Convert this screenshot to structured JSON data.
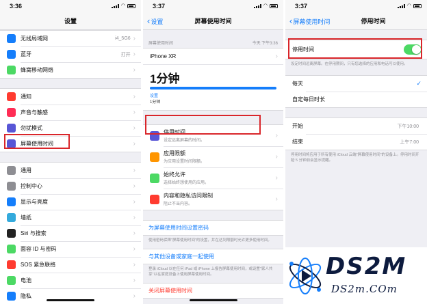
{
  "colors": {
    "accent": "#157efb",
    "highlight": "#d9252a",
    "toggle_on": "#4cd964",
    "destructive": "#ff3b30"
  },
  "p1": {
    "time": "3:36",
    "title": "设置",
    "group1": [
      {
        "label": "无线局域网",
        "value": "i4_5G6",
        "icon": "wifi-icon",
        "color": "#157efb"
      },
      {
        "label": "蓝牙",
        "value": "打开",
        "icon": "bluetooth-icon",
        "color": "#157efb"
      },
      {
        "label": "蜂窝移动网络",
        "value": "",
        "icon": "cellular-icon",
        "color": "#4cd964"
      }
    ],
    "group2": [
      {
        "label": "通知",
        "icon": "notifications-icon",
        "color": "#ff3b30"
      },
      {
        "label": "声音与触感",
        "icon": "sounds-icon",
        "color": "#ff2d55"
      },
      {
        "label": "勿扰模式",
        "icon": "moon-icon",
        "color": "#5856d6"
      },
      {
        "label": "屏幕使用时间",
        "icon": "hourglass-icon",
        "color": "#5856d6"
      }
    ],
    "group3": [
      {
        "label": "通用",
        "icon": "gear-icon",
        "color": "#8e8e93"
      },
      {
        "label": "控制中心",
        "icon": "control-center-icon",
        "color": "#8e8e93"
      },
      {
        "label": "显示与亮度",
        "icon": "display-icon",
        "color": "#157efb"
      },
      {
        "label": "墙纸",
        "icon": "wallpaper-icon",
        "color": "#34aadc"
      },
      {
        "label": "Siri 与搜索",
        "icon": "siri-icon",
        "color": "#222222"
      },
      {
        "label": "面容 ID 与密码",
        "icon": "faceid-icon",
        "color": "#4cd964"
      },
      {
        "label": "SOS 紧急联络",
        "icon": "sos-icon",
        "color": "#ff3b30"
      },
      {
        "label": "电池",
        "icon": "battery-icon",
        "color": "#4cd964"
      },
      {
        "label": "隐私",
        "icon": "hand-icon",
        "color": "#157efb"
      }
    ]
  },
  "p2": {
    "time": "3:37",
    "back": "设置",
    "title": "屏幕使用时间",
    "header_left": "屏幕使用时间",
    "header_right": "今天 下午3:36",
    "device": "iPhone XR",
    "big_time": "1分钟",
    "cat_label": "设置",
    "cat_value": "1分钟",
    "items": [
      {
        "title": "停用时间",
        "sub": "设定远离屏幕的时间。",
        "icon": "downtime-icon",
        "color": "#5856d6"
      },
      {
        "title": "应用限额",
        "sub": "为应用设置时间限额。",
        "icon": "app-limits-icon",
        "color": "#ff9500"
      },
      {
        "title": "始终允许",
        "sub": "选择始终想使用的应用。",
        "icon": "always-allowed-icon",
        "color": "#4cd964"
      },
      {
        "title": "内容和隐私访问限制",
        "sub": "阻止不当内容。",
        "icon": "restrictions-icon",
        "color": "#ff3b30"
      }
    ],
    "passcode_link": "为屏幕使用时间设置密码",
    "passcode_note": "使用密码保障\"屏幕使用时间\"的设置，并在达到限额时允许更多使用时间。",
    "share_link": "与其他设备或家庭一起使用",
    "share_note": "登录 iCloud 以在任何 iPad 或 iPhone 上报告屏幕使用时间，或设置\"家人共享\"以在家庭设备上使用屏幕使用时间。",
    "disable_link": "关闭屏幕使用时间"
  },
  "p3": {
    "time": "3:37",
    "back": "屏幕使用时间",
    "title": "停用时间",
    "toggle_label": "停用时间",
    "toggle_on": true,
    "toggle_note": "设定时间远离屏幕。在停用期间，只有您选择的应用和电话可以使用。",
    "schedule": [
      {
        "label": "每天",
        "checked": true
      },
      {
        "label": "自定每日时长",
        "checked": false
      }
    ],
    "start_label": "开始",
    "start_value": "下午10:00",
    "end_label": "结束",
    "end_value": "上午7:00",
    "end_note": "停用时间将应用于所有使用 iCloud 云端\"屏幕使用时间\"的设备上。停用时间开始 5 分钟前会显示提醒。"
  },
  "watermark": {
    "brand": "DS2M",
    "site": "DS2m.COm"
  }
}
